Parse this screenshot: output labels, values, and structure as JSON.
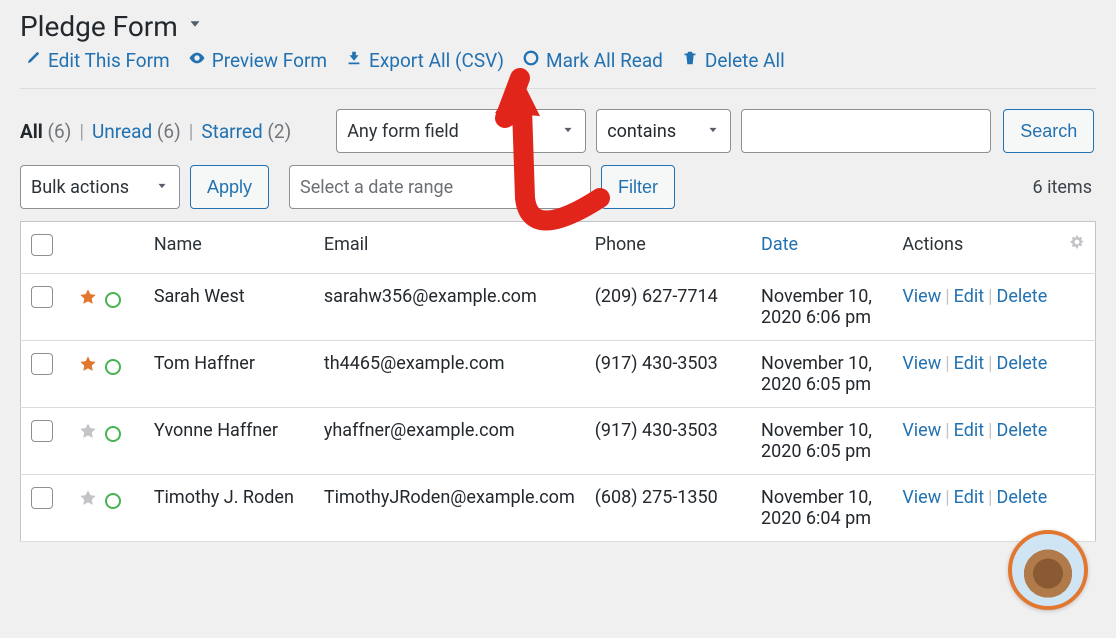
{
  "header": {
    "title": "Pledge Form",
    "actions": {
      "edit": "Edit This Form",
      "preview": "Preview Form",
      "export": "Export All (CSV)",
      "mark_read": "Mark All Read",
      "delete_all": "Delete All"
    }
  },
  "filters": {
    "all_label": "All",
    "all_count": "(6)",
    "unread_label": "Unread",
    "unread_count": "(6)",
    "starred_label": "Starred",
    "starred_count": "(2)",
    "any_field": "Any form field",
    "condition": "contains",
    "search": "Search",
    "bulk": "Bulk actions",
    "apply": "Apply",
    "date_range_placeholder": "Select a date range",
    "filter": "Filter",
    "items_count": "6 items"
  },
  "columns": {
    "name": "Name",
    "email": "Email",
    "phone": "Phone",
    "date": "Date",
    "actions": "Actions"
  },
  "action_labels": {
    "view": "View",
    "edit": "Edit",
    "delete": "Delete"
  },
  "rows": [
    {
      "starred": true,
      "name": "Sarah West",
      "email": "sarahw356@example.com",
      "phone": "(209) 627-7714",
      "date": "November 10, 2020 6:06 pm"
    },
    {
      "starred": true,
      "name": "Tom Haffner",
      "email": "th4465@example.com",
      "phone": "(917) 430-3503",
      "date": "November 10, 2020 6:05 pm"
    },
    {
      "starred": false,
      "name": "Yvonne Haffner",
      "email": "yhaffner@example.com",
      "phone": "(917) 430-3503",
      "date": "November 10, 2020 6:05 pm"
    },
    {
      "starred": false,
      "name": "Timothy J. Roden",
      "email": "TimothyJRoden@example.com",
      "phone": "(608) 275-1350",
      "date": "November 10, 2020 6:04 pm"
    }
  ]
}
